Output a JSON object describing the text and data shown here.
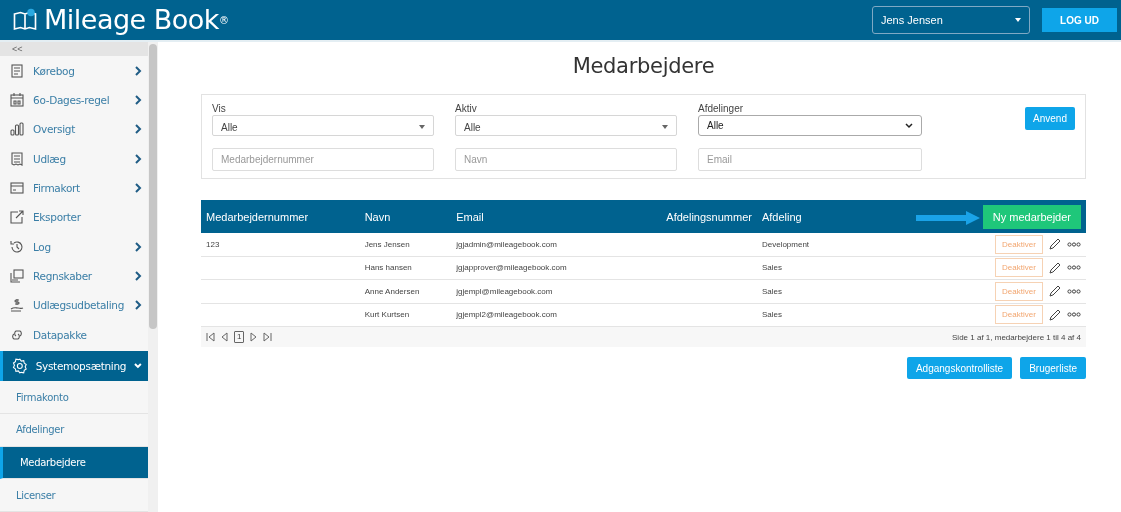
{
  "header": {
    "logo_text": "Mileage Book",
    "logo_mark": "®",
    "user_select": {
      "value": "Jens Jensen"
    },
    "logout_label": "LOG UD"
  },
  "sidebar": {
    "collapse_label": "<<",
    "items": [
      {
        "label": "Kørebog",
        "kind": "menu",
        "expanded": false,
        "selected": false
      },
      {
        "label": "6o-Dages-regel",
        "kind": "menu",
        "expanded": false,
        "selected": false
      },
      {
        "label": "Oversigt",
        "kind": "menu",
        "expanded": false,
        "selected": false
      },
      {
        "label": "Udlæg",
        "kind": "menu",
        "expanded": false,
        "selected": false
      },
      {
        "label": "Firmakort",
        "kind": "menu",
        "expanded": false,
        "selected": false
      },
      {
        "label": "Eksporter",
        "kind": "link",
        "expanded": false,
        "selected": false
      },
      {
        "label": "Log",
        "kind": "menu",
        "expanded": false,
        "selected": false
      },
      {
        "label": "Regnskaber",
        "kind": "menu",
        "expanded": false,
        "selected": false
      },
      {
        "label": "Udlægsudbetaling",
        "kind": "menu",
        "expanded": false,
        "selected": false
      },
      {
        "label": "Datapakke",
        "kind": "link",
        "expanded": false,
        "selected": false
      },
      {
        "label": "Systemopsætning",
        "kind": "menu",
        "expanded": true,
        "selected": true,
        "children": [
          {
            "label": "Firmakonto",
            "selected": false
          },
          {
            "label": "Afdelinger",
            "selected": false
          },
          {
            "label": "Medarbejdere",
            "selected": true
          },
          {
            "label": "Licenser",
            "selected": false
          }
        ]
      }
    ]
  },
  "page_title": "Medarbejdere",
  "filters": {
    "selects": [
      {
        "label": "Vis",
        "value": "Alle",
        "kind": "custom"
      },
      {
        "label": "Aktiv",
        "value": "Alle",
        "kind": "custom"
      },
      {
        "label": "Afdelinger",
        "value": "Alle",
        "kind": "native"
      }
    ],
    "apply_label": "Anvend",
    "inputs": [
      {
        "placeholder": "Medarbejdernummer"
      },
      {
        "placeholder": "Navn"
      },
      {
        "placeholder": "Email"
      }
    ]
  },
  "table": {
    "columns": [
      "Medarbejdernummer",
      "Navn",
      "Email",
      "Afdelingsnummer",
      "Afdeling"
    ],
    "new_label": "Ny medarbejder",
    "rows": [
      {
        "number": "123",
        "name": "Jens Jensen",
        "email": "jgjadmin@mileagebook.com",
        "department": "Development",
        "action": "Deaktiver"
      },
      {
        "name": "Hans hansen",
        "email": "jgjapprover@mileagebook.com",
        "department": "Sales",
        "action": "Deaktiver"
      },
      {
        "name": "Anne Andersen",
        "email": "jgjempl@mileagebook.com",
        "department": "Sales",
        "action": "Deaktiver"
      },
      {
        "name": "Kurt Kurtsen",
        "email": "jgjempl2@mileagebook.com",
        "department": "Sales",
        "action": "Deaktiver"
      }
    ],
    "pager": {
      "page": "1",
      "summary": "Side 1 af 1, medarbejdere 1 til 4 af 4"
    }
  },
  "footer_buttons": [
    "Adgangskontrolliste",
    "Brugerliste"
  ]
}
